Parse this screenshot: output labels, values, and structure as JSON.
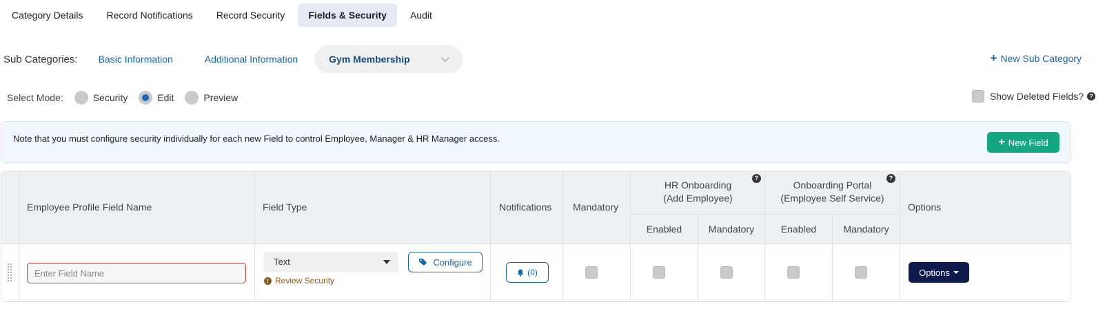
{
  "tabs": [
    {
      "label": "Category Details",
      "active": false
    },
    {
      "label": "Record Notifications",
      "active": false
    },
    {
      "label": "Record Security",
      "active": false
    },
    {
      "label": "Fields & Security",
      "active": true
    },
    {
      "label": "Audit",
      "active": false
    }
  ],
  "subcategories": {
    "label": "Sub Categories:",
    "items": [
      "Basic Information",
      "Additional Information"
    ],
    "selected": "Gym Membership",
    "new_label": "New Sub Category"
  },
  "mode": {
    "label": "Select Mode:",
    "options": [
      "Security",
      "Edit",
      "Preview"
    ],
    "selected": "Edit",
    "show_deleted_label": "Show Deleted Fields?"
  },
  "notice": {
    "text": "Note that you must configure security individually for each new Field to control Employee, Manager & HR Manager access.",
    "new_field_label": "New Field"
  },
  "table": {
    "headers": {
      "field_name": "Employee Profile Field Name",
      "field_type": "Field Type",
      "notifications": "Notifications",
      "mandatory": "Mandatory",
      "hr_onboarding_line1": "HR Onboarding",
      "hr_onboarding_line2": "(Add Employee)",
      "onboarding_portal_line1": "Onboarding Portal",
      "onboarding_portal_line2": "(Employee Self Service)",
      "options": "Options",
      "enabled": "Enabled",
      "sub_mandatory": "Mandatory"
    },
    "row": {
      "field_name_placeholder": "Enter Field Name",
      "field_type": "Text",
      "review_security": "Review Security",
      "configure_label": "Configure",
      "notifications_label": "(0)",
      "options_label": "Options"
    }
  },
  "colors": {
    "link": "#1565a8",
    "active_tab_bg": "#e6e9f6",
    "new_field_bg": "#17a683",
    "options_bg": "#0f1b4d",
    "error_border": "#c0392b"
  }
}
